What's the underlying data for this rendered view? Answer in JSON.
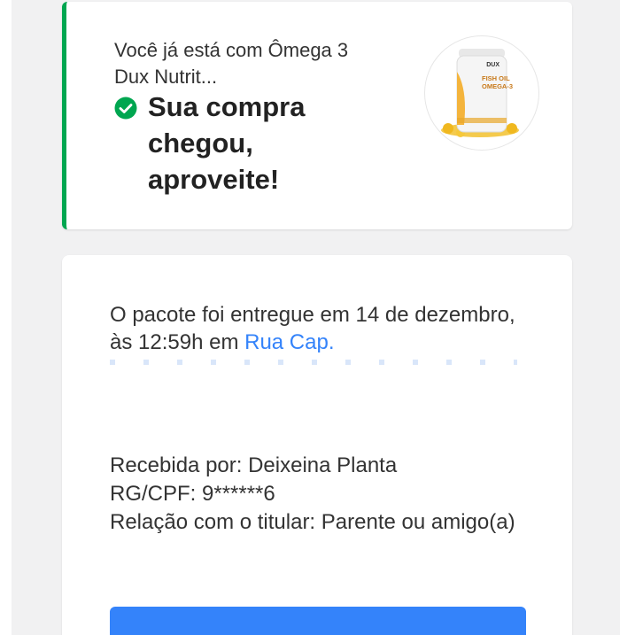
{
  "status_card": {
    "subtitle": "Você já está com Ômega 3 Dux Nutrit...",
    "title": "Sua compra chegou, aproveite!",
    "accent_color": "#00a650",
    "status_icon": "check-circle-icon",
    "product_image": "fish-oil-omega-3-bottle",
    "product_label_brand": "DUX",
    "product_label_line1": "FISH OIL",
    "product_label_line2": "OMEGA-3"
  },
  "details_card": {
    "delivery_text": "O pacote foi entregue em 14 de dezembro, às 12:59h em ",
    "address_link": "Rua Cap.",
    "received_by": "Recebida por: Deixeina Planta",
    "document": "RG/CPF: 9******6",
    "relationship": "Relação com o titular: Parente ou amigo(a)",
    "link_color": "#3483fa"
  },
  "primary_button": {
    "label": ""
  }
}
